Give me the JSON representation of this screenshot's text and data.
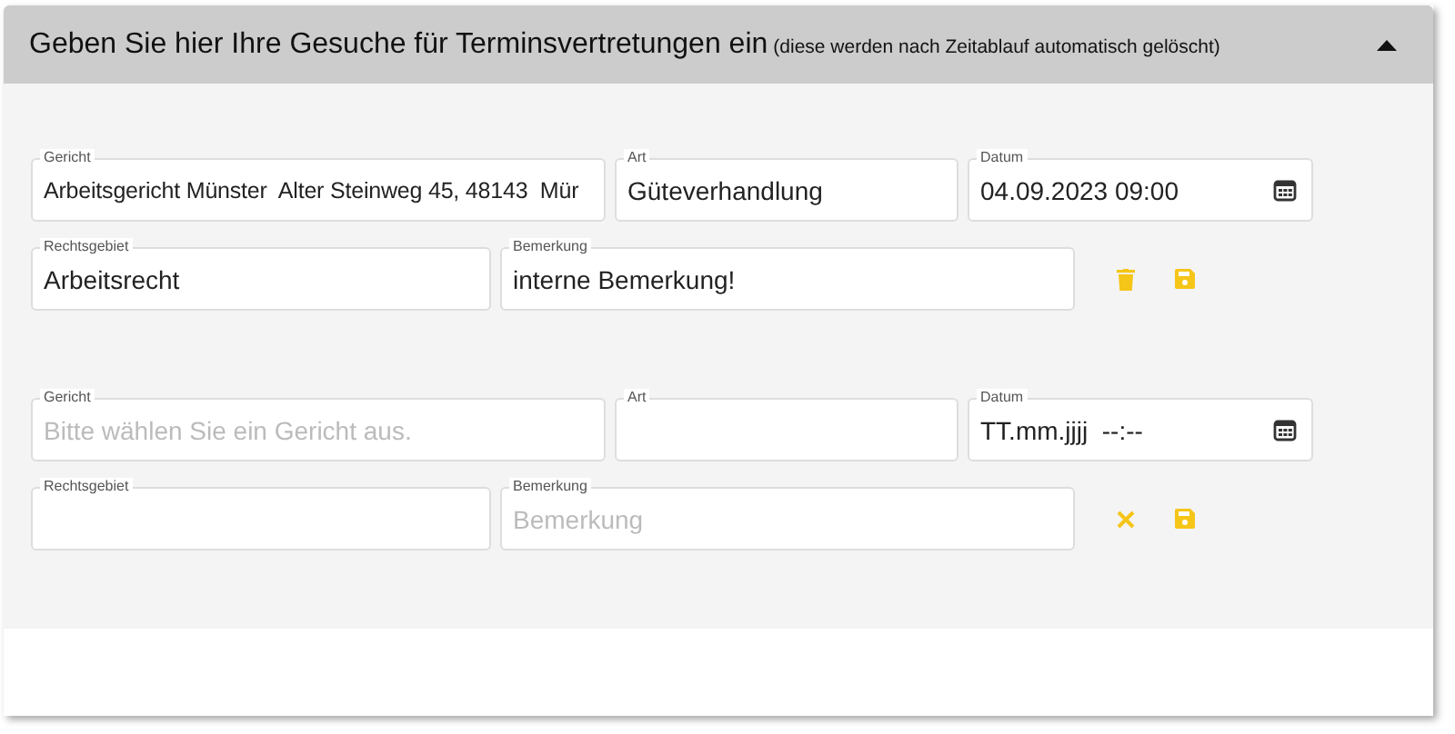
{
  "header": {
    "title": "Geben Sie hier Ihre Gesuche für Terminsvertretungen ein",
    "note": "(diese werden nach Zeitablauf automatisch gelöscht)",
    "expanded": true
  },
  "entries": [
    {
      "gericht": {
        "label": "Gericht",
        "value": "Arbeitsgericht Münster  Alter Steinweg 45, 48143  Mür"
      },
      "art": {
        "label": "Art",
        "value": "Güteverhandlung"
      },
      "datum": {
        "label": "Datum",
        "value": "04.09.2023 09:00"
      },
      "rechtsgebiet": {
        "label": "Rechtsgebiet",
        "value": "Arbeitsrecht"
      },
      "bemerkung": {
        "label": "Bemerkung",
        "value": "interne Bemerkung!"
      },
      "actions": [
        {
          "kind": "delete"
        },
        {
          "kind": "save"
        }
      ]
    },
    {
      "gericht": {
        "label": "Gericht",
        "placeholder": "Bitte wählen Sie ein Gericht aus."
      },
      "art": {
        "label": "Art"
      },
      "datum": {
        "label": "Datum",
        "value": "TT.mm.jjjj  --:--"
      },
      "rechtsgebiet": {
        "label": "Rechtsgebiet"
      },
      "bemerkung": {
        "label": "Bemerkung",
        "placeholder": "Bemerkung"
      },
      "actions": [
        {
          "kind": "cancel"
        },
        {
          "kind": "save"
        }
      ]
    }
  ]
}
